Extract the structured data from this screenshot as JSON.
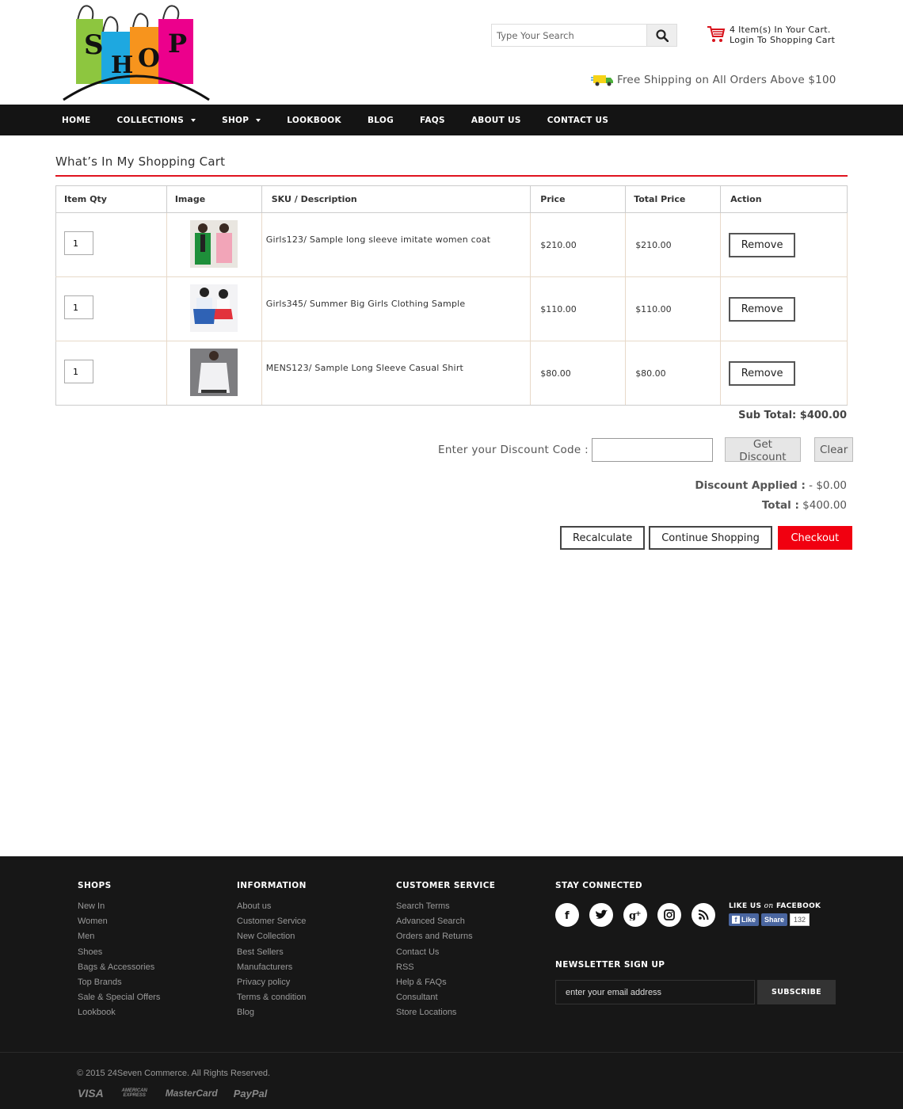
{
  "header": {
    "logo_text": "SHOP",
    "search_placeholder": "Type Your Search",
    "cart_line1": "4  Item(s) In Your Cart.",
    "cart_line2": "Login To Shopping Cart",
    "shipping_text": "Free Shipping on All Orders Above $100"
  },
  "nav": {
    "items": [
      "HOME",
      "COLLECTIONS",
      "SHOP",
      "LOOKBOOK",
      "BLOG",
      "FAQS",
      "ABOUT US",
      "CONTACT US"
    ]
  },
  "cart": {
    "title": "What’s In My Shopping Cart",
    "columns": [
      "Item Qty",
      "Image",
      "SKU / Description",
      "Price",
      "Total Price",
      "Action"
    ],
    "rows": [
      {
        "qty": "1",
        "description": "Girls123/ Sample long sleeve imitate women coat",
        "price": "$210.00",
        "total": "$210.00",
        "action": "Remove"
      },
      {
        "qty": "1",
        "description": "Girls345/ Summer Big Girls Clothing Sample",
        "price": "$110.00",
        "total": "$110.00",
        "action": "Remove"
      },
      {
        "qty": "1",
        "description": "MENS123/ Sample Long Sleeve Casual Shirt",
        "price": "$80.00",
        "total": "$80.00",
        "action": "Remove"
      }
    ],
    "subtotal_label": "Sub Total:",
    "subtotal_value": "$400.00",
    "discount_label": "Enter your Discount Code :",
    "get_discount": "Get Discount",
    "clear": "Clear",
    "discount_applied_label": "Discount Applied :",
    "discount_applied_value": " - $0.00",
    "total_label": "Total :",
    "total_value": " $400.00",
    "recalculate": "Recalculate",
    "continue": "Continue Shopping",
    "checkout": "Checkout"
  },
  "footer": {
    "shops": {
      "title": "SHOPS",
      "items": [
        "New In",
        "Women",
        "Men",
        "Shoes",
        "Bags & Accessories",
        "Top Brands",
        "Sale & Special Offers",
        "Lookbook"
      ]
    },
    "information": {
      "title": "INFORMATION",
      "items": [
        "About us",
        "Customer Service",
        "New Collection",
        "Best Sellers",
        "Manufacturers",
        "Privacy policy",
        "Terms & condition",
        "Blog"
      ]
    },
    "customer_service": {
      "title": "CUSTOMER SERVICE",
      "items": [
        "Search Terms",
        "Advanced Search",
        "Orders and Returns",
        "Contact Us",
        "RSS",
        "Help & FAQs",
        "Consultant",
        "Store Locations"
      ]
    },
    "stay_connected": "STAY CONNECTED",
    "like_us": "LIKE US",
    "like_on": "on",
    "like_facebook": "FACEBOOK",
    "fb_like": "Like",
    "fb_share": "Share",
    "fb_count": "132",
    "newsletter_title": "NEWSLETTER SIGN UP",
    "newsletter_placeholder": "enter your email address",
    "subscribe": "SUBSCRIBE",
    "copyright": "© 2015 24Seven Commerce. All Rights Reserved.",
    "cards": [
      "VISA",
      "AMERICAN EXPRESS",
      "MasterCard",
      "PayPal"
    ]
  },
  "colors": {
    "accent": "#f10010",
    "nav_bg": "#141414",
    "footer_bg": "#171717"
  }
}
